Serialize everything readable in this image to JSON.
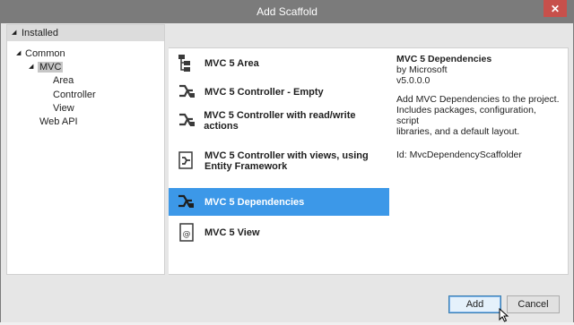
{
  "window": {
    "title": "Add Scaffold",
    "close_glyph": "✕"
  },
  "left_panel": {
    "header": "Installed",
    "tree": [
      {
        "label": "Common"
      },
      {
        "label": "MVC"
      },
      {
        "label": "Area"
      },
      {
        "label": "Controller"
      },
      {
        "label": "View"
      },
      {
        "label": "Web API"
      }
    ]
  },
  "scaffolds": [
    {
      "label": "MVC 5 Area",
      "icon": "area-icon"
    },
    {
      "label": "MVC 5 Controller - Empty",
      "icon": "controller-icon"
    },
    {
      "label": "MVC 5 Controller with read/write actions",
      "icon": "controller-icon"
    },
    {
      "label": "MVC 5 Controller with views, using Entity Framework",
      "icon": "controller-view-icon"
    },
    {
      "label": "MVC 5 Dependencies",
      "icon": "dependencies-icon",
      "selected": true
    },
    {
      "label": "MVC 5 View",
      "icon": "view-icon"
    }
  ],
  "details": {
    "name": "MVC 5 Dependencies",
    "author": "by Microsoft",
    "version": "v5.0.0.0",
    "description_lines": [
      "Add MVC Dependencies to the project.",
      "Includes packages, configuration, script",
      "libraries, and a default layout."
    ],
    "id_line": "Id: MvcDependencyScaffolder"
  },
  "buttons": {
    "add": "Add",
    "cancel": "Cancel"
  },
  "colors": {
    "selection": "#3c98e8",
    "titlebar": "#7b7b7b",
    "close": "#c7504b"
  }
}
